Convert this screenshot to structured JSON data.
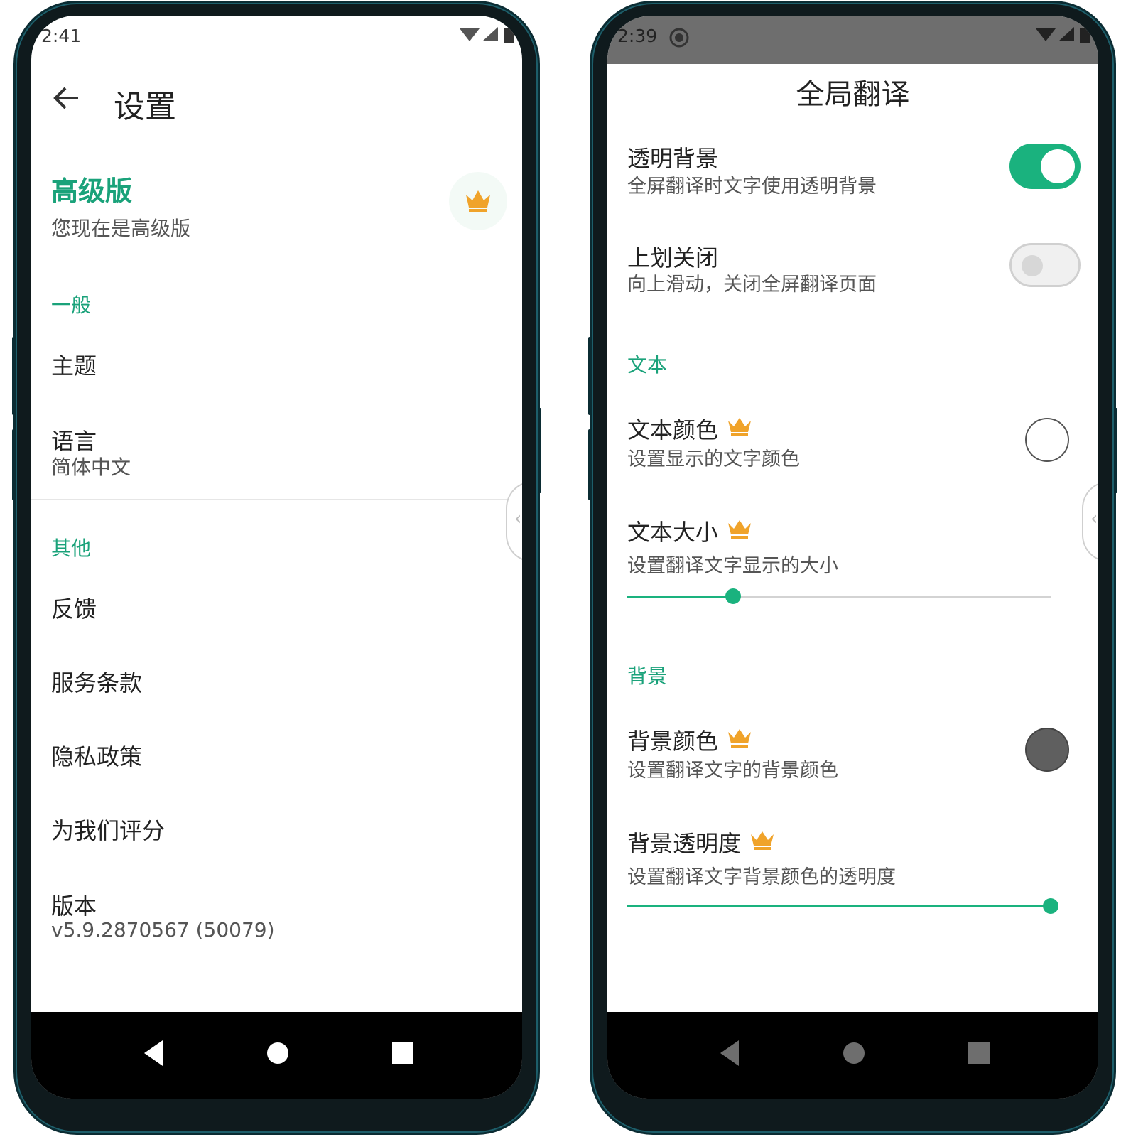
{
  "left": {
    "status": {
      "time": "2:41"
    },
    "toolbar": {
      "title": "设置"
    },
    "premium": {
      "title": "高级版",
      "subtitle": "您现在是高级版"
    },
    "sections": {
      "general": "一般",
      "other": "其他"
    },
    "items": {
      "theme": "主题",
      "language": "语言",
      "language_value": "简体中文",
      "feedback": "反馈",
      "terms": "服务条款",
      "privacy": "隐私政策",
      "rate": "为我们评分",
      "version": "版本",
      "version_value": "v5.9.2870567 (50079)"
    }
  },
  "right": {
    "status": {
      "time": "2:39"
    },
    "title": "全局翻译",
    "settings": {
      "transparent_bg": {
        "label": "透明背景",
        "sub": "全屏翻译时文字使用透明背景",
        "on": true
      },
      "swipe_close": {
        "label": "上划关闭",
        "sub": "向上滑动，关闭全屏翻译页面",
        "on": false
      },
      "text_section": "文本",
      "text_color": {
        "label": "文本颜色",
        "sub": "设置显示的文字颜色",
        "color": "#ffffff"
      },
      "text_size": {
        "label": "文本大小",
        "sub": "设置翻译文字显示的大小",
        "value_fraction": 0.25
      },
      "bg_section": "背景",
      "bg_color": {
        "label": "背景颜色",
        "sub": "设置翻译文字的背景颜色",
        "color": "#5f5f5f"
      },
      "bg_opacity": {
        "label": "背景透明度",
        "sub": "设置翻译文字背景颜色的透明度",
        "value_fraction": 1.0
      }
    }
  },
  "colors": {
    "accent": "#1aa27a",
    "crown": "#f0a32a"
  },
  "icons": [
    "back-arrow-icon",
    "crown-icon",
    "wifi-icon",
    "signal-icon",
    "battery-icon",
    "nav-back-icon",
    "nav-home-icon",
    "nav-recents-icon",
    "screen-record-icon",
    "edge-panel-chevron-icon"
  ]
}
